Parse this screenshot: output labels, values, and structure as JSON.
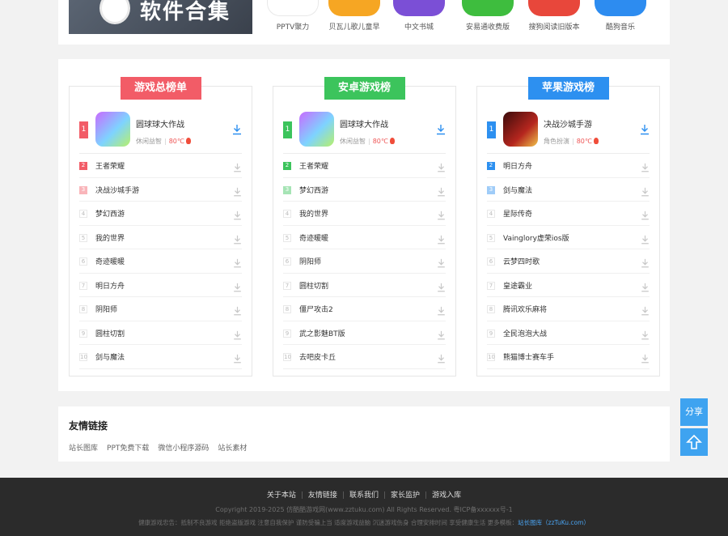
{
  "banner": {
    "text": "软件合集"
  },
  "apps": [
    {
      "label": "PPTV聚力",
      "color": "#ffffff"
    },
    {
      "label": "贝瓦儿歌儿童早",
      "color": "#f6a623"
    },
    {
      "label": "中文书城",
      "color": "#7b4fd6"
    },
    {
      "label": "安易通收费版",
      "color": "#3ebd3e"
    },
    {
      "label": "搜狗阅读旧版本",
      "color": "#e8473b"
    },
    {
      "label": "酷狗音乐",
      "color": "#2d8cf0"
    }
  ],
  "boards": [
    {
      "title": "游戏总榜单",
      "color": "#f25c67",
      "top": {
        "rank": "1",
        "name": "圆球球大作战",
        "category": "休闲益智",
        "temp": "80℃"
      },
      "items": [
        {
          "rank": "2",
          "name": "王者荣耀"
        },
        {
          "rank": "3",
          "name": "决战沙城手游"
        },
        {
          "rank": "4",
          "name": "梦幻西游"
        },
        {
          "rank": "5",
          "name": "我的世界"
        },
        {
          "rank": "6",
          "name": "奇迹暖暖"
        },
        {
          "rank": "7",
          "name": "明日方舟"
        },
        {
          "rank": "8",
          "name": "阴阳师"
        },
        {
          "rank": "9",
          "name": "圆柱切割"
        },
        {
          "rank": "10",
          "name": "剑与魔法"
        }
      ]
    },
    {
      "title": "安卓游戏榜",
      "color": "#3cc45c",
      "top": {
        "rank": "1",
        "name": "圆球球大作战",
        "category": "休闲益智",
        "temp": "80℃"
      },
      "items": [
        {
          "rank": "2",
          "name": "王者荣耀"
        },
        {
          "rank": "3",
          "name": "梦幻西游"
        },
        {
          "rank": "4",
          "name": "我的世界"
        },
        {
          "rank": "5",
          "name": "奇迹暖暖"
        },
        {
          "rank": "6",
          "name": "阴阳师"
        },
        {
          "rank": "7",
          "name": "圆柱切割"
        },
        {
          "rank": "8",
          "name": "僵尸攻击2"
        },
        {
          "rank": "9",
          "name": "武之影魅BT版"
        },
        {
          "rank": "10",
          "name": "去吧皮卡丘"
        }
      ]
    },
    {
      "title": "苹果游戏榜",
      "color": "#2d90f0",
      "top": {
        "rank": "1",
        "name": "决战沙城手游",
        "category": "角色扮演",
        "temp": "80℃"
      },
      "items": [
        {
          "rank": "2",
          "name": "明日方舟"
        },
        {
          "rank": "3",
          "name": "剑与魔法"
        },
        {
          "rank": "4",
          "name": "星际传奇"
        },
        {
          "rank": "5",
          "name": "Vainglory虚荣ios版"
        },
        {
          "rank": "6",
          "name": "云梦四时歌"
        },
        {
          "rank": "7",
          "name": "皇途霸业"
        },
        {
          "rank": "8",
          "name": "腾讯欢乐麻将"
        },
        {
          "rank": "9",
          "name": "全民泡泡大战"
        },
        {
          "rank": "10",
          "name": "熊猫博士赛车手"
        }
      ]
    }
  ],
  "friend_links": {
    "title": "友情链接",
    "items": [
      "站长图库",
      "PPT免费下载",
      "微信小程序源码",
      "站长素材"
    ]
  },
  "float": {
    "share": "分享"
  },
  "footer": {
    "nav": [
      "关于本站",
      "友情链接",
      "联系我们",
      "家长监护",
      "游戏入库"
    ],
    "copyright": "Copyright 2019-2025 仿酷酷游戏网(www.zztuku.com) All Rights Reserved. 粤ICP备xxxxxx号-1",
    "tips": "健康游戏忠告：抵制不良游戏 拒绝盗版游戏 注意自我保护 谨防受骗上当 适度游戏益脑 沉迷游戏伤身 合理安排时间 享受健康生活 更多模板：",
    "tips_link": "站长图库（zzTuKu.com）"
  }
}
